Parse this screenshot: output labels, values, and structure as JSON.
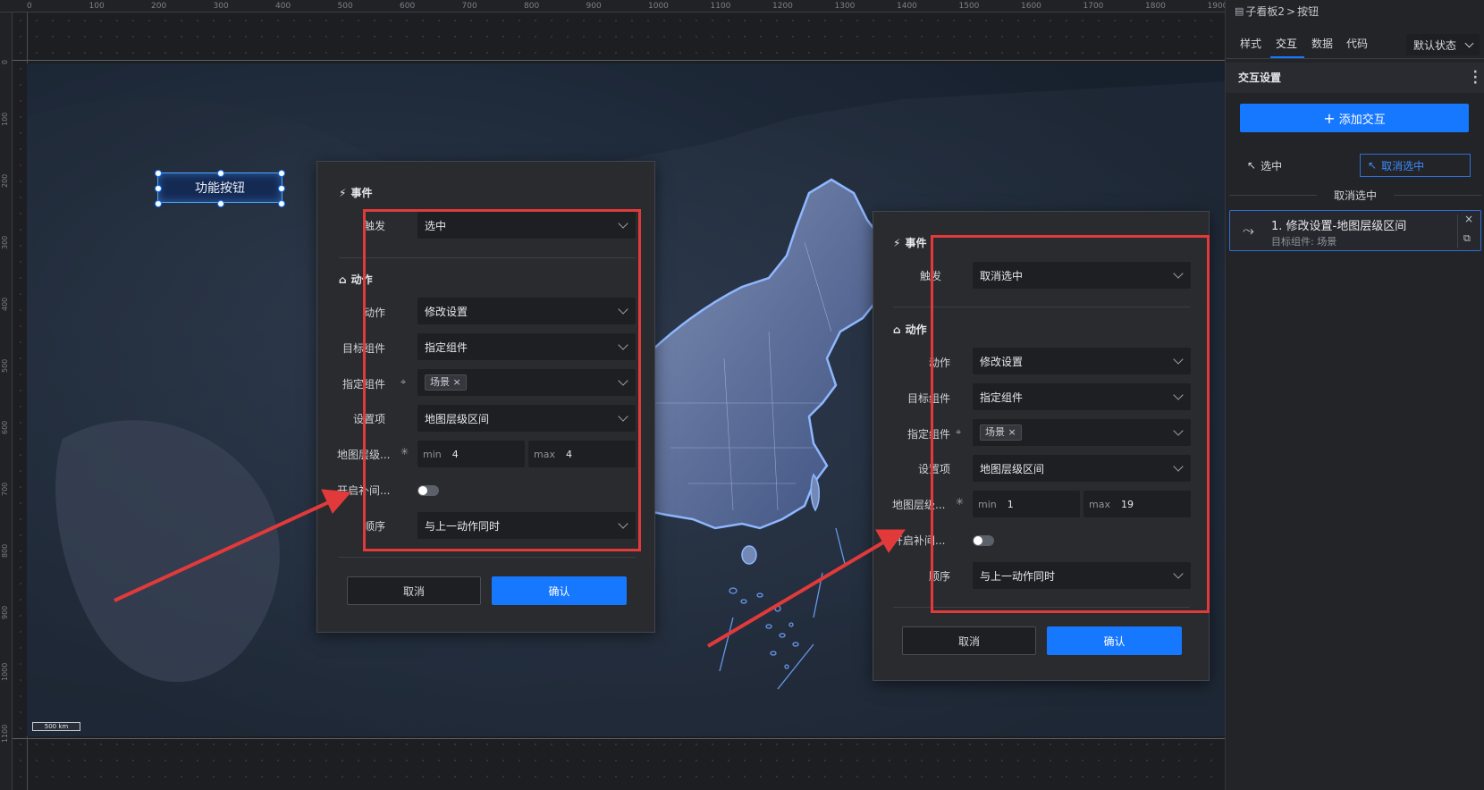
{
  "ruler": {
    "top_ticks": [
      "0",
      "100",
      "200",
      "300",
      "400",
      "500",
      "600",
      "700",
      "800",
      "900",
      "1000",
      "1100",
      "1200",
      "1300",
      "1400",
      "1500",
      "1600",
      "1700",
      "1800",
      "1900"
    ],
    "left_ticks": [
      "0",
      "100",
      "200",
      "300",
      "400",
      "500",
      "600",
      "700",
      "800",
      "900",
      "1000",
      "1100"
    ]
  },
  "map": {
    "scale_label": "500 km"
  },
  "canvas": {
    "function_button_label": "功能按钮"
  },
  "dialog_left": {
    "event_title": "事件",
    "trigger_label": "触发",
    "trigger_value": "选中",
    "action_title": "动作",
    "action_label": "动作",
    "action_value": "修改设置",
    "target_label": "目标组件",
    "target_value": "指定组件",
    "specified_label": "指定组件",
    "specified_tag": "场景",
    "setting_label": "设置项",
    "setting_value": "地图层级区间",
    "zoom_label": "地图层级...",
    "min_label": "min",
    "min_value": "4",
    "max_label": "max",
    "max_value": "4",
    "tween_label": "开启补间...",
    "order_label": "顺序",
    "order_value": "与上一动作同时",
    "cancel": "取消",
    "confirm": "确认"
  },
  "dialog_right": {
    "event_title": "事件",
    "trigger_label": "触发",
    "trigger_value": "取消选中",
    "action_title": "动作",
    "action_label": "动作",
    "action_value": "修改设置",
    "target_label": "目标组件",
    "target_value": "指定组件",
    "specified_label": "指定组件",
    "specified_tag": "场景",
    "setting_label": "设置项",
    "setting_value": "地图层级区间",
    "zoom_label": "地图层级...",
    "min_label": "min",
    "min_value": "1",
    "max_label": "max",
    "max_value": "19",
    "tween_label": "开启补间...",
    "order_label": "顺序",
    "order_value": "与上一动作同时",
    "cancel": "取消",
    "confirm": "确认"
  },
  "panel": {
    "breadcrumb_parent": "子看板2",
    "breadcrumb_sep": ">",
    "breadcrumb_current": "按钮",
    "tabs": [
      "样式",
      "交互",
      "数据",
      "代码"
    ],
    "active_tab": "交互",
    "state_select": "默认状态",
    "section_title": "交互设置",
    "add_button": "添加交互",
    "option_selected": "选中",
    "option_deselected": "取消选中",
    "group_label": "取消选中",
    "item_title": "1. 修改设置-地图层级区间",
    "item_subtitle": "目标组件: 场景"
  },
  "colors": {
    "accent": "#1677ff",
    "highlight_box": "#e23a3a",
    "arrow": "#e23a3a",
    "glow": "#4aa8ff"
  }
}
